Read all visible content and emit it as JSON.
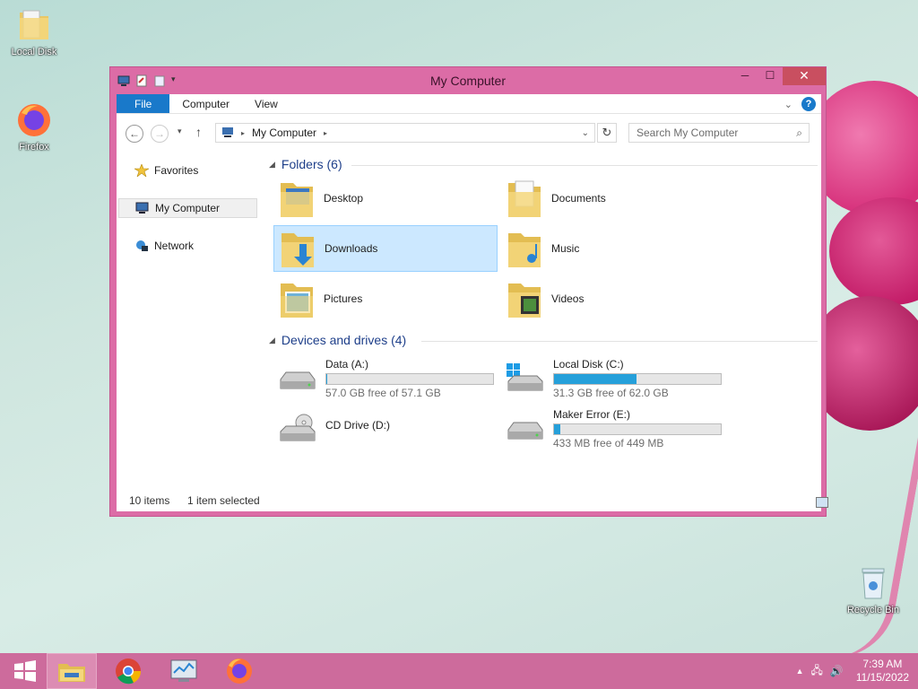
{
  "desktop": {
    "icons": [
      {
        "label": "Local Disk"
      },
      {
        "label": "Firefox"
      },
      {
        "label": "Recycle Bin"
      }
    ]
  },
  "window": {
    "title": "My Computer",
    "ribbon_tabs": [
      "File",
      "Computer",
      "View"
    ],
    "address": {
      "path": "My Computer"
    },
    "search": {
      "placeholder": "Search My Computer"
    },
    "nav": {
      "favorites": "Favorites",
      "my_computer": "My Computer",
      "network": "Network"
    },
    "folders_group": {
      "label": "Folders (6)"
    },
    "folders": [
      {
        "name": "Desktop",
        "selected": false
      },
      {
        "name": "Documents",
        "selected": false
      },
      {
        "name": "Downloads",
        "selected": true
      },
      {
        "name": "Music",
        "selected": false
      },
      {
        "name": "Pictures",
        "selected": false
      },
      {
        "name": "Videos",
        "selected": false
      }
    ],
    "drives_group": {
      "label": "Devices and drives (4)"
    },
    "drives": [
      {
        "name": "Data (A:)",
        "free": "57.0 GB free of 57.1 GB",
        "used_fraction": 0.002
      },
      {
        "name": "Local Disk (C:)",
        "free": "31.3 GB free of 62.0 GB",
        "used_fraction": 0.495
      },
      {
        "name": "CD Drive (D:)",
        "free": "",
        "used_fraction": null
      },
      {
        "name": "Maker Error (E:)",
        "free": "433 MB free of 449 MB",
        "used_fraction": 0.036
      }
    ],
    "status": {
      "items": "10 items",
      "selected": "1 item selected"
    }
  },
  "taskbar": {
    "time": "7:39 AM",
    "date": "11/15/2022"
  },
  "colors": {
    "accent": "#1979ca",
    "window_frame": "#dc6ca6",
    "taskbar": "#cd6b9c",
    "drive_bar": "#26a0da",
    "selection": "#cce8ff"
  }
}
